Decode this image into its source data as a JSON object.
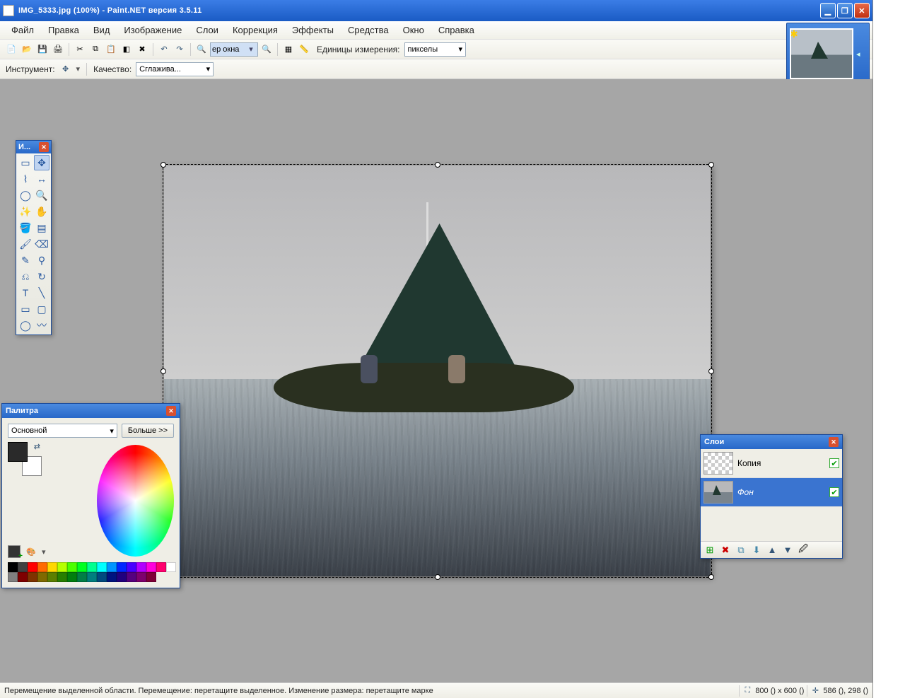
{
  "titlebar": {
    "text": "IMG_5333.jpg (100%) - Paint.NET версия 3.5.11"
  },
  "menus": [
    "Файл",
    "Правка",
    "Вид",
    "Изображение",
    "Слои",
    "Коррекция",
    "Эффекты",
    "Средства",
    "Окно",
    "Справка"
  ],
  "toolbar": {
    "zoom_value": "ер окна",
    "units_label": "Единицы измерения:",
    "units_value": "пикселы",
    "icons": [
      "new-icon",
      "open-icon",
      "save-icon",
      "print-icon",
      "cut-icon",
      "copy-icon",
      "paste-icon",
      "crop-icon",
      "deselect-icon",
      "undo-icon",
      "redo-icon",
      "zoomout-icon",
      "zoomin-icon",
      "grid-icon",
      "ruler-icon"
    ]
  },
  "toolbar2": {
    "tool_label": "Инструмент:",
    "quality_label": "Качество:",
    "quality_value": "Сглажива..."
  },
  "toolswin": {
    "title": "И...",
    "tools": [
      "rect-select-tool",
      "move-tool",
      "lasso-tool",
      "move-sel-tool",
      "ellipse-select-tool",
      "zoom-tool",
      "magic-wand-tool",
      "pan-tool",
      "paint-bucket-tool",
      "gradient-tool",
      "brush-tool",
      "eraser-tool",
      "pencil-tool",
      "color-picker-tool",
      "clone-stamp-tool",
      "recolor-tool",
      "text-tool",
      "line-tool",
      "rectangle-tool",
      "rounded-rect-tool",
      "ellipse-tool",
      "freeform-tool"
    ],
    "selected": "move-tool"
  },
  "palette": {
    "title": "Палитра",
    "mode": "Основной",
    "more": "Больше >>",
    "swatches": [
      "#000000",
      "#404040",
      "#ff0000",
      "#ff6a00",
      "#ffd800",
      "#b6ff00",
      "#4cff00",
      "#00ff21",
      "#00ff90",
      "#00ffff",
      "#0094ff",
      "#0026ff",
      "#4800ff",
      "#b200ff",
      "#ff00dc",
      "#ff006e",
      "#ffffff",
      "#808080",
      "#7f0000",
      "#7f3300",
      "#7f6a00",
      "#5b7f00",
      "#267f00",
      "#007f0e",
      "#007f46",
      "#007f7f",
      "#004a7f",
      "#00137f",
      "#21007f",
      "#57007f",
      "#7f006e",
      "#7f0037"
    ]
  },
  "layers": {
    "title": "Слои",
    "items": [
      {
        "name": "Копия",
        "visible": true,
        "selected": false,
        "transparent": true
      },
      {
        "name": "Фон",
        "visible": true,
        "selected": true,
        "transparent": false
      }
    ],
    "buttons": [
      "add-layer-icon",
      "delete-layer-icon",
      "duplicate-layer-icon",
      "merge-down-icon",
      "move-up-icon",
      "move-down-icon",
      "properties-icon"
    ]
  },
  "statusbar": {
    "text": "Перемещение выделенной области. Перемещение: перетащите выделенное. Изменение размера: перетащите марке",
    "size": "800 () x 600 ()",
    "pos": "586 (), 298 ()"
  }
}
